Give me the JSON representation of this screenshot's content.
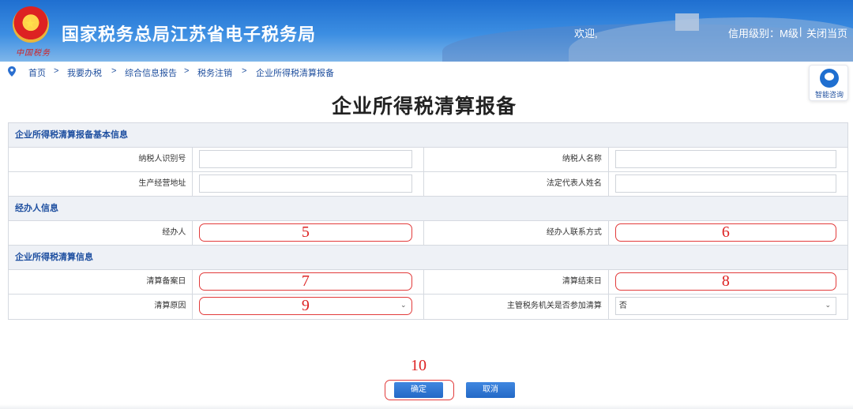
{
  "header": {
    "site_title": "国家税务总局江苏省电子税务局",
    "brand_sub": "中国税务",
    "welcome": "欢迎,",
    "credit_level": "信用级别：M级",
    "separator": "|",
    "close_page": "关闭当页"
  },
  "breadcrumb": {
    "items": [
      "首页",
      "我要办税",
      "综合信息报告",
      "税务注销",
      "企业所得税清算报备"
    ],
    "separator": ">"
  },
  "assistant": {
    "label": "智能咨询"
  },
  "page": {
    "title": "企业所得税清算报备"
  },
  "form": {
    "sections": [
      {
        "title": "企业所得税清算报备基本信息",
        "rows": [
          {
            "left_label": "纳税人识别号",
            "left_value": "",
            "right_label": "纳税人名称",
            "right_value": ""
          },
          {
            "left_label": "生产经营地址",
            "left_value": "",
            "right_label": "法定代表人姓名",
            "right_value": ""
          }
        ]
      },
      {
        "title": "经办人信息",
        "rows": [
          {
            "left_label": "经办人",
            "left_marker": "5",
            "right_label": "经办人联系方式",
            "right_marker": "6"
          }
        ]
      },
      {
        "title": "企业所得税清算信息",
        "rows": [
          {
            "left_label": "清算备案日",
            "left_marker": "7",
            "right_label": "清算结束日",
            "right_marker": "8"
          },
          {
            "left_label": "清算原因",
            "left_marker": "9",
            "right_label": "主管税务机关是否参加清算",
            "right_value": "否"
          }
        ]
      }
    ]
  },
  "buttons": {
    "confirm": "确定",
    "cancel": "取消",
    "confirm_marker": "10"
  },
  "colors": {
    "header_blue": "#1f6fd0",
    "section_text": "#1e4fa0",
    "highlight_red": "#e23b3b",
    "button_blue": "#2a6fd0"
  }
}
